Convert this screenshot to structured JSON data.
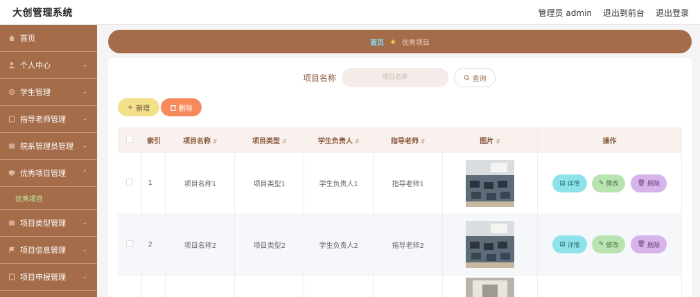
{
  "header": {
    "app_title": "大创管理系统",
    "links": [
      "管理员 admin",
      "退出到前台",
      "退出登录"
    ]
  },
  "sidebar": {
    "items": [
      {
        "label": "首页",
        "icon": "home-icon",
        "has_chevron": false
      },
      {
        "label": "个人中心",
        "icon": "user-icon",
        "has_chevron": true
      },
      {
        "label": "学生管理",
        "icon": "gear-icon",
        "has_chevron": true
      },
      {
        "label": "指导老师管理",
        "icon": "doc-icon",
        "has_chevron": true
      },
      {
        "label": "院系管理员管理",
        "icon": "list-icon",
        "has_chevron": true
      },
      {
        "label": "优秀项目管理",
        "icon": "screen-icon",
        "has_chevron": true,
        "expanded": true
      },
      {
        "label": "项目类型管理",
        "icon": "list-icon",
        "has_chevron": true
      },
      {
        "label": "项目信息管理",
        "icon": "flag-icon",
        "has_chevron": true
      },
      {
        "label": "项目申报管理",
        "icon": "doc-icon",
        "has_chevron": true
      }
    ],
    "sub_item": "优秀项目"
  },
  "breadcrumb": {
    "home": "首页",
    "current": "优秀项目"
  },
  "search": {
    "label": "项目名称",
    "placeholder": "项目名称",
    "button": "查询"
  },
  "toolbar": {
    "add": "新增",
    "delete": "删除"
  },
  "table": {
    "columns": [
      "索引",
      "项目名称",
      "项目类型",
      "学生负责人",
      "指导老师",
      "图片",
      "操作"
    ],
    "rows": [
      {
        "index": "1",
        "name": "项目名称1",
        "type": "项目类型1",
        "leader": "学生负责人1",
        "teacher": "指导老师1"
      },
      {
        "index": "2",
        "name": "项目名称2",
        "type": "项目类型2",
        "leader": "学生负责人2",
        "teacher": "指导老师2"
      }
    ],
    "actions": {
      "detail": "详情",
      "edit": "修改",
      "delete": "删除"
    }
  },
  "colors": {
    "sidebar_bg": "#a56c4a",
    "breadcrumb_home": "#7fe0ff",
    "active_sub": "#c6f0a0",
    "add_btn": "#f2e08b",
    "delete_btn": "#f78a5a"
  }
}
